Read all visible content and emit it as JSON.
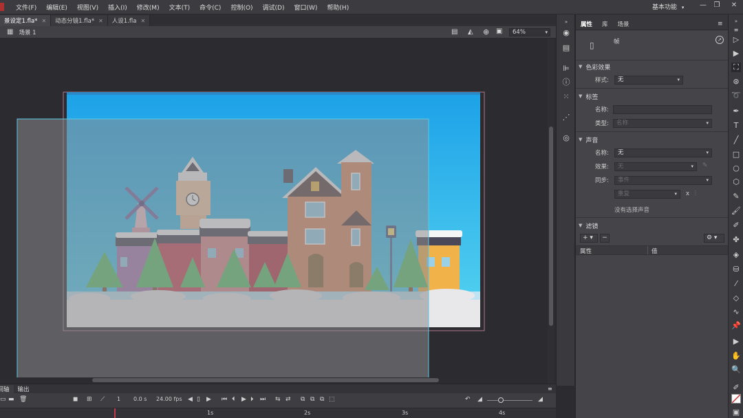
{
  "menu": {
    "items": [
      "文件(F)",
      "编辑(E)",
      "视图(V)",
      "插入(I)",
      "修改(M)",
      "文本(T)",
      "命令(C)",
      "控制(O)",
      "调试(D)",
      "窗口(W)",
      "帮助(H)"
    ],
    "workspace": "基本功能"
  },
  "tabs": [
    {
      "label": "景设定1.fla*",
      "active": true
    },
    {
      "label": "动态分镜1.fla*",
      "active": false
    },
    {
      "label": "人设1.fla",
      "active": false
    }
  ],
  "scene": {
    "label": "场景 1",
    "zoom": "64%"
  },
  "props": {
    "tabs": [
      "属性",
      "库",
      "场景"
    ],
    "frame_label": "帧",
    "color_effect": {
      "title": "色彩效果",
      "style_label": "样式:",
      "style_value": "无"
    },
    "label_section": {
      "title": "标签",
      "name_label": "名称:",
      "type_label": "类型:",
      "type_value": "名称"
    },
    "sound": {
      "title": "声音",
      "name_label": "名称:",
      "name_value": "无",
      "effect_label": "效果:",
      "effect_value": "无",
      "sync_label": "同步:",
      "sync_value": "事件",
      "repeat_value": "重复",
      "x_label": "x",
      "no_sound": "没有选择声音"
    },
    "filter": {
      "title": "滤镜",
      "col_property": "属性",
      "col_value": "值"
    }
  },
  "timeline": {
    "tabs": [
      "时间轴",
      "输出"
    ],
    "frame": "1",
    "time": "0.0 s",
    "fps": "24.00 fps",
    "ruler": [
      "1s",
      "2s",
      "3s",
      "4s"
    ]
  },
  "colors": {
    "sky_top": "#1ea2e8",
    "sky_bottom": "#4fd0f0",
    "snow": "#e8e8ea",
    "brick": "#d98a62"
  }
}
